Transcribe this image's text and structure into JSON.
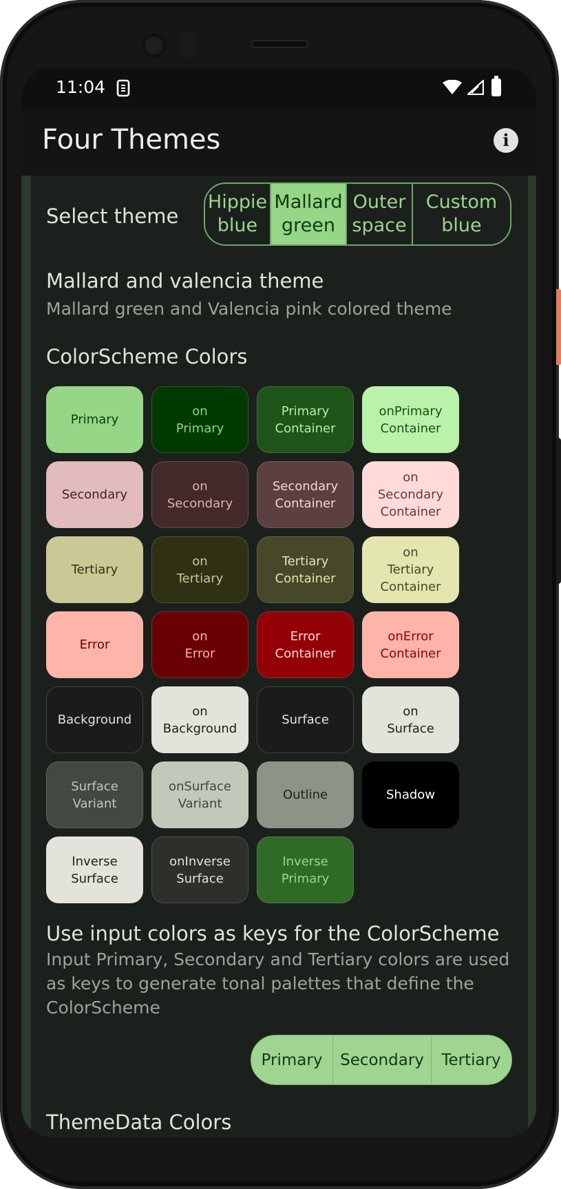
{
  "status_bar": {
    "time": "11:04"
  },
  "app_bar": {
    "title": "Four Themes"
  },
  "theme_select": {
    "label": "Select theme",
    "options": [
      {
        "line1": "Hippie",
        "line2": "blue",
        "selected": false
      },
      {
        "line1": "Mallard",
        "line2": "green",
        "selected": true
      },
      {
        "line1": "Outer",
        "line2": "space",
        "selected": false
      },
      {
        "line1": "Custom",
        "line2": "blue",
        "selected": false
      }
    ]
  },
  "theme_info": {
    "title": "Mallard and valencia theme",
    "subtitle": "Mallard green and Valencia pink colored theme"
  },
  "colorscheme": {
    "heading": "ColorScheme Colors",
    "swatches": [
      {
        "label": "Primary",
        "bg": "#96d687",
        "fg": "#0e3a10"
      },
      {
        "label": "on\nPrimary",
        "bg": "#013a01",
        "fg": "#94d286"
      },
      {
        "label": "Primary\nContainer",
        "bg": "#1d5518",
        "fg": "#b4eea5"
      },
      {
        "label": "onPrimary\nContainer",
        "bg": "#b9f2a8",
        "fg": "#1b4f16"
      },
      {
        "label": "Secondary",
        "bg": "#e2bbbc",
        "fg": "#3a2526"
      },
      {
        "label": "on\nSecondary",
        "bg": "#44292a",
        "fg": "#d9b3b4"
      },
      {
        "label": "Secondary\nContainer",
        "bg": "#5c3f40",
        "fg": "#f2d8d8"
      },
      {
        "label": "on\nSecondary\nContainer",
        "bg": "#ffdad9",
        "fg": "#5a3d3e"
      },
      {
        "label": "Tertiary",
        "bg": "#c8c995",
        "fg": "#2f3013"
      },
      {
        "label": "on\nTertiary",
        "bg": "#303113",
        "fg": "#c6c893"
      },
      {
        "label": "Tertiary\nContainer",
        "bg": "#47482a",
        "fg": "#e4e6b0"
      },
      {
        "label": "on\nTertiary\nContainer",
        "bg": "#e4e6af",
        "fg": "#454628"
      },
      {
        "label": "Error",
        "bg": "#ffb4a9",
        "fg": "#690005"
      },
      {
        "label": "on\nError",
        "bg": "#690004",
        "fg": "#ffb3a8"
      },
      {
        "label": "Error\nContainer",
        "bg": "#930006",
        "fg": "#ffdad4"
      },
      {
        "label": "onError\nContainer",
        "bg": "#ffb4a9",
        "fg": "#930006"
      },
      {
        "label": "Background",
        "bg": "#1b1c19",
        "fg": "#e3e3dc"
      },
      {
        "label": "on\nBackground",
        "bg": "#e3e3dc",
        "fg": "#1d1e1a"
      },
      {
        "label": "Surface",
        "bg": "#1b1c19",
        "fg": "#e3e3dc"
      },
      {
        "label": "on\nSurface",
        "bg": "#e3e3dc",
        "fg": "#1d1e1a"
      },
      {
        "label": "Surface\nVariant",
        "bg": "#424940",
        "fg": "#c1c9bc"
      },
      {
        "label": "onSurface\nVariant",
        "bg": "#c2c9bb",
        "fg": "#3f463c"
      },
      {
        "label": "Outline",
        "bg": "#8c9387",
        "fg": "#20231f"
      },
      {
        "label": "Shadow",
        "bg": "#000000",
        "fg": "#ffffff"
      },
      {
        "label": "Inverse\nSurface",
        "bg": "#e3e3dc",
        "fg": "#1d1e1a"
      },
      {
        "label": "onInverse\nSurface",
        "bg": "#2e2f2b",
        "fg": "#e3e3dc"
      },
      {
        "label": "Inverse\nPrimary",
        "bg": "#2f6b27",
        "fg": "#9fd391"
      }
    ]
  },
  "input_keys": {
    "title": "Use input colors as keys for the ColorScheme",
    "description": "Input Primary, Secondary and Tertiary colors are used as keys to generate tonal palettes that define the ColorScheme",
    "buttons": [
      "Primary",
      "Secondary",
      "Tertiary"
    ]
  },
  "themedata": {
    "heading": "ThemeData Colors"
  }
}
